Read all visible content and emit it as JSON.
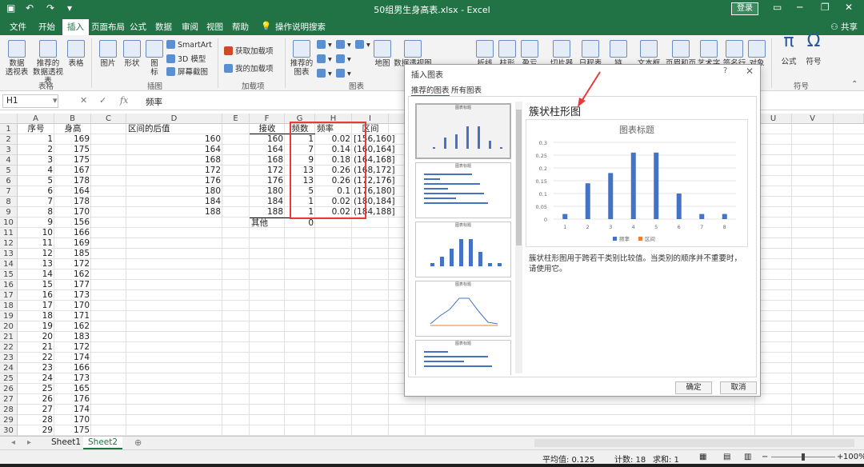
{
  "window": {
    "title": "50组男生身高表.xlsx - Excel",
    "login": "登录"
  },
  "ribbon_tabs": [
    "文件",
    "开始",
    "插入",
    "页面布局",
    "公式",
    "数据",
    "审阅",
    "视图",
    "帮助"
  ],
  "search_tip": "操作说明搜索",
  "share": "共享",
  "ribbon": {
    "buttons": {
      "pivot": "数据\n透视表",
      "recommended_pivot": "推荐的\n数据透视表",
      "table": "表格",
      "picture": "图片",
      "shapes": "形状",
      "icons": "图\n标",
      "smartart": "SmartArt",
      "model3d": "3D 模型",
      "screenshot": "屏幕截图",
      "get_addins": "获取加载项",
      "my_addins": "我的加载项",
      "recommended_charts": "推荐的\n图表",
      "maps": "地图",
      "pivot_chart": "数据透视图",
      "map3d": "三维地",
      "line": "折线",
      "column": "柱形",
      "winloss": "盈亏",
      "slicer": "切片器",
      "timeline": "日程表",
      "link": "链",
      "textbox": "文本框",
      "header_footer": "页眉和页脚",
      "wordart": "艺术字",
      "signature": "签名行",
      "object": "对象",
      "formula": "公式",
      "symbol": "符号"
    },
    "groups": {
      "tables": "表格",
      "illustrations": "插图",
      "addins": "加载项",
      "charts": "图表",
      "symbols": "符号"
    }
  },
  "formula_bar": {
    "name_box": "H1",
    "fx": "fx",
    "value": "频率"
  },
  "columns": [
    "A",
    "B",
    "C",
    "D",
    "E",
    "F",
    "G",
    "H",
    "I",
    "J",
    "U",
    "V"
  ],
  "sheet": {
    "headers": {
      "A1": "序号",
      "B1": "身高",
      "D1": "区间的后值",
      "F1": "接收",
      "G1": "频数",
      "H1": "频率",
      "I1": "区间"
    },
    "seq": [
      "1",
      "2",
      "3",
      "4",
      "5",
      "6",
      "7",
      "8",
      "9",
      "10",
      "11",
      "12",
      "13",
      "14",
      "15",
      "16",
      "17",
      "18",
      "19",
      "20",
      "21",
      "22",
      "23",
      "24",
      "25",
      "26",
      "27",
      "28",
      "29"
    ],
    "height": [
      "169",
      "175",
      "175",
      "167",
      "178",
      "164",
      "178",
      "170",
      "156",
      "166",
      "169",
      "185",
      "172",
      "162",
      "177",
      "173",
      "170",
      "171",
      "162",
      "183",
      "172",
      "174",
      "166",
      "173",
      "165",
      "176",
      "174",
      "170",
      "175"
    ],
    "bin_end": [
      "160",
      "164",
      "168",
      "172",
      "176",
      "180",
      "184",
      "188"
    ],
    "receive": [
      "160",
      "164",
      "168",
      "172",
      "176",
      "180",
      "184",
      "188"
    ],
    "freq": [
      "1",
      "7",
      "9",
      "13",
      "13",
      "5",
      "1",
      "1"
    ],
    "rate": [
      "0.02",
      "0.14",
      "0.18",
      "0.26",
      "0.26",
      "0.1",
      "0.02",
      "0.02"
    ],
    "interval": [
      "[156,160]",
      "(160,164]",
      "(164,168]",
      "(168,172]",
      "(172,176]",
      "(176,180]",
      "(180,184]",
      "(184,188]"
    ],
    "other_label": "其他",
    "other_value": "0"
  },
  "sheet_tabs": [
    "Sheet1",
    "Sheet2"
  ],
  "status": {
    "average": "平均值: 0.125",
    "count": "计数: 18",
    "sum": "求和: 1",
    "zoom": "100%"
  },
  "dialog": {
    "title": "插入图表",
    "help": "?",
    "tabs": [
      "推荐的图表",
      "所有图表"
    ],
    "preview_title": "簇状柱形图",
    "description": "簇状柱形图用于跨若干类别比较值。当类别的顺序并不重要时，请使用它。",
    "ok": "确定",
    "cancel": "取消",
    "thumb_labels": [
      "图表标题",
      "图表标题",
      "图表标题",
      "图表标题",
      "图表标题"
    ]
  },
  "chart_data": {
    "type": "bar",
    "title": "图表标题",
    "categories": [
      "1",
      "2",
      "3",
      "4",
      "5",
      "6",
      "7",
      "8"
    ],
    "series": [
      {
        "name": "频率",
        "values": [
          0.02,
          0.14,
          0.18,
          0.26,
          0.26,
          0.1,
          0.02,
          0.02
        ]
      },
      {
        "name": "区间",
        "values": []
      }
    ],
    "ylim": [
      0,
      0.3
    ],
    "yticks": [
      "0",
      "0.05",
      "0.1",
      "0.15",
      "0.2",
      "0.25",
      "0.3"
    ],
    "grid": true,
    "legend": "bottom",
    "colors": {
      "series1": "#4472c4",
      "series2": "#ed7d31"
    }
  }
}
